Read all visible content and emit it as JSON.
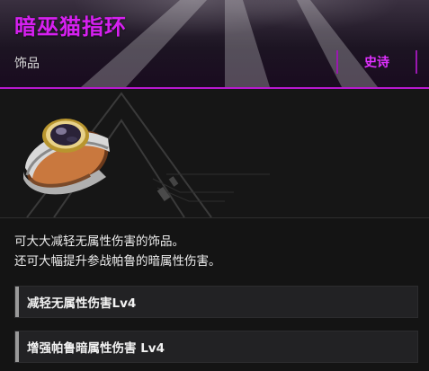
{
  "item": {
    "name": "暗巫猫指环",
    "category": "饰品",
    "rarity": "史诗",
    "icon": "ring-icon",
    "description": [
      "可大大减轻无属性伤害的饰品。",
      "还可大幅提升参战帕鲁的暗属性伤害。"
    ],
    "effects": [
      "减轻无属性伤害Lv4",
      "增强帕鲁暗属性伤害 Lv4"
    ]
  },
  "colors": {
    "title": "#d620f0",
    "rarity": "#e030ff",
    "accent_line": "#b818d0"
  }
}
